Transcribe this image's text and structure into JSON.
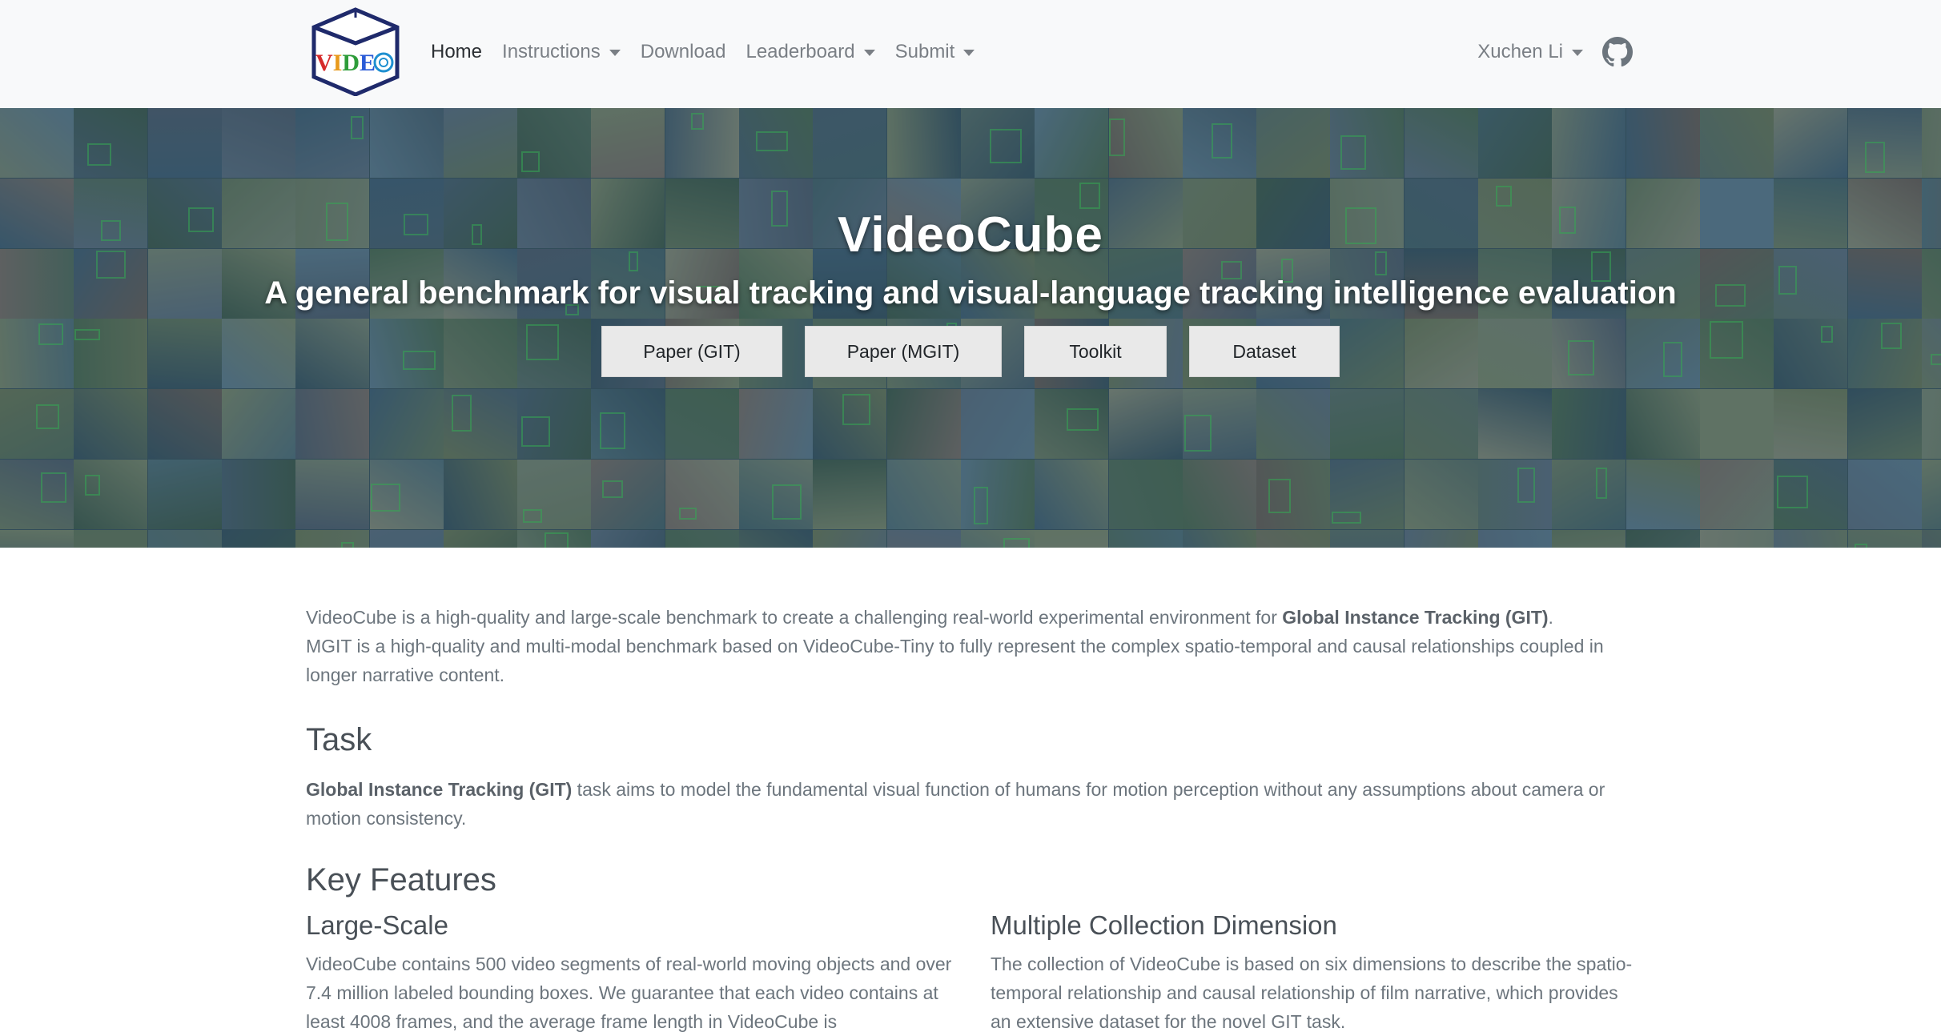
{
  "navbar": {
    "logo_text": "VIDEO",
    "items": [
      {
        "label": "Home",
        "active": true,
        "dropdown": false
      },
      {
        "label": "Instructions",
        "active": false,
        "dropdown": true
      },
      {
        "label": "Download",
        "active": false,
        "dropdown": false
      },
      {
        "label": "Leaderboard",
        "active": false,
        "dropdown": true
      },
      {
        "label": "Submit",
        "active": false,
        "dropdown": true
      }
    ],
    "user": "Xuchen Li",
    "github_icon": "github-icon"
  },
  "hero": {
    "title": "VideoCube",
    "subtitle": "A general benchmark for visual tracking and visual-language tracking intelligence evaluation",
    "buttons": [
      "Paper (GIT)",
      "Paper (MGIT)",
      "Toolkit",
      "Dataset"
    ]
  },
  "intro": {
    "p1_before": "VideoCube is a high-quality and large-scale benchmark to create a challenging real-world experimental environment for ",
    "p1_bold": "Global Instance Tracking (GIT)",
    "p1_after": ".",
    "p2": "MGIT is a high-quality and multi-modal benchmark based on VideoCube-Tiny to fully represent the complex spatio-temporal and causal relationships coupled in longer narrative content."
  },
  "task": {
    "heading": "Task",
    "bold": "Global Instance Tracking (GIT)",
    "text": " task aims to model the fundamental visual function of humans for motion perception without any assumptions about camera or motion consistency."
  },
  "features": {
    "heading": "Key Features",
    "items": [
      {
        "title": "Large-Scale",
        "text": "VideoCube contains 500 video segments of real-world moving objects and over 7.4 million labeled bounding boxes. We guarantee that each video contains at least 4008 frames, and the average frame length in VideoCube is"
      },
      {
        "title": "Multiple Collection Dimension",
        "text": "The collection of VideoCube is based on six dimensions to describe the spatio-temporal relationship and causal relationship of film narrative, which provides an extensive dataset for the novel GIT task."
      }
    ]
  }
}
